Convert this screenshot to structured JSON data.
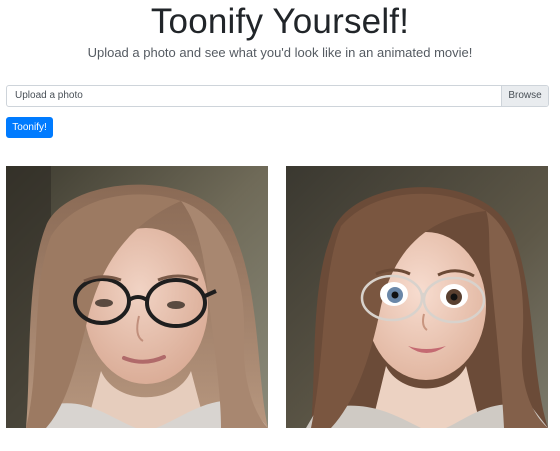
{
  "header": {
    "title": "Toonify Yourself!",
    "subtitle": "Upload a photo and see what you'd look like in an animated movie!"
  },
  "upload": {
    "label": "Upload a photo",
    "browse_label": "Browse"
  },
  "actions": {
    "toonify_label": "Toonify!"
  },
  "colors": {
    "primary": "#007bff",
    "input_border": "#ced4da",
    "browse_bg": "#e9ecef"
  }
}
